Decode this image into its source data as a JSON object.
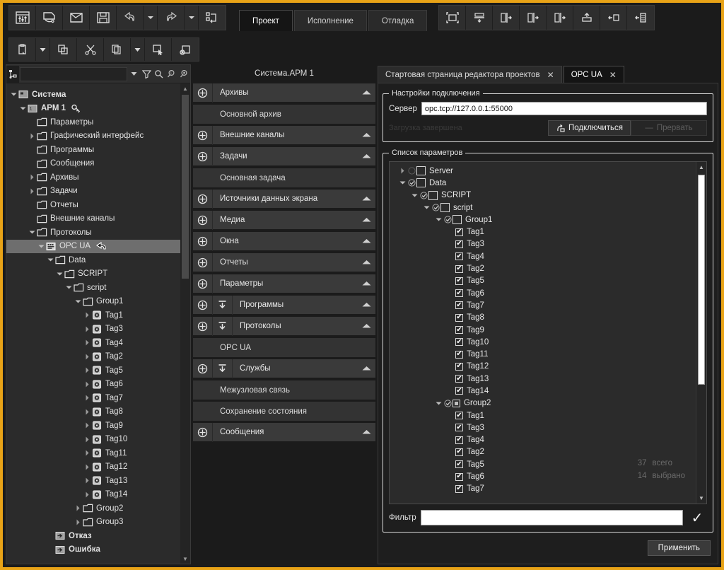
{
  "colors": {
    "accent": "#e8a317",
    "panel": "#2b2b2b",
    "bg": "#1b1b1b",
    "selection": "#6e6e6e"
  },
  "toolbar_main": {
    "buttons": [
      {
        "name": "project-settings-icon",
        "label": "Настройки проекта"
      },
      {
        "name": "new-project-icon",
        "label": "Новый проект"
      },
      {
        "name": "open-folder-icon",
        "label": "Открыть"
      },
      {
        "name": "save-icon",
        "label": "Сохранить"
      },
      {
        "name": "undo-icon",
        "label": "Отменить"
      },
      {
        "name": "undo-dropdown-icon",
        "label": ""
      },
      {
        "name": "redo-icon",
        "label": "Повторить"
      },
      {
        "name": "redo-dropdown-icon",
        "label": ""
      },
      {
        "name": "rebuild-icon",
        "label": "Пересобрать"
      }
    ]
  },
  "tabs": [
    {
      "label": "Проект",
      "active": true
    },
    {
      "label": "Исполнение",
      "active": false
    },
    {
      "label": "Отладка",
      "active": false
    }
  ],
  "toolbar_right": {
    "buttons": [
      {
        "name": "select-frame-icon",
        "label": "Рамка выделения"
      },
      {
        "name": "align-bottom-icon",
        "label": "Выровнять вниз"
      },
      {
        "name": "align-right-1-icon",
        "label": "Выровнять вправо"
      },
      {
        "name": "align-right-2-icon",
        "label": "Выровнять вправо"
      },
      {
        "name": "align-right-3-icon",
        "label": "Выровнять вправо"
      },
      {
        "name": "bring-front-icon",
        "label": "На передний план"
      },
      {
        "name": "align-left-icon",
        "label": "Выровнять влево"
      },
      {
        "name": "dock-left-icon",
        "label": "Закрепить слева"
      }
    ]
  },
  "toolbar_edit": {
    "buttons": [
      {
        "name": "paste-icon",
        "label": "Вставить"
      },
      {
        "name": "paste-dropdown-icon",
        "label": ""
      },
      {
        "name": "copy-icon",
        "label": "Копировать"
      },
      {
        "name": "cut-icon",
        "label": "Вырезать"
      },
      {
        "name": "duplicate-icon",
        "label": "Дублировать"
      },
      {
        "name": "duplicate-dropdown-icon",
        "label": ""
      },
      {
        "name": "select-icon",
        "label": "Выделить"
      },
      {
        "name": "delete-icon",
        "label": "Удалить"
      }
    ]
  },
  "tree_toolbar": {
    "mode_icon": "tree-mode-icon",
    "search_value": "",
    "search_placeholder": "",
    "buttons": [
      {
        "name": "search-dropdown-icon"
      },
      {
        "name": "filter-icon"
      },
      {
        "name": "search-icon"
      },
      {
        "name": "find-prev-icon"
      },
      {
        "name": "find-next-icon"
      }
    ]
  },
  "tree": {
    "nodes": [
      {
        "label": "Система",
        "depth": 0,
        "icon": "system-icon",
        "twisty": "down",
        "bold": true
      },
      {
        "label": "АРМ 1",
        "depth": 1,
        "icon": "workstation-icon",
        "twisty": "down",
        "bold": true,
        "badge": "key-icon"
      },
      {
        "label": "Параметры",
        "depth": 2,
        "icon": "folder-icon",
        "twisty": ""
      },
      {
        "label": "Графический интерфейс",
        "depth": 2,
        "icon": "folder-icon",
        "twisty": "right"
      },
      {
        "label": "Программы",
        "depth": 2,
        "icon": "folder-icon",
        "twisty": ""
      },
      {
        "label": "Сообщения",
        "depth": 2,
        "icon": "folder-icon",
        "twisty": ""
      },
      {
        "label": "Архивы",
        "depth": 2,
        "icon": "folder-icon",
        "twisty": "right"
      },
      {
        "label": "Задачи",
        "depth": 2,
        "icon": "folder-icon",
        "twisty": "right"
      },
      {
        "label": "Отчеты",
        "depth": 2,
        "icon": "folder-icon",
        "twisty": ""
      },
      {
        "label": "Внешние каналы",
        "depth": 2,
        "icon": "folder-icon",
        "twisty": ""
      },
      {
        "label": "Протоколы",
        "depth": 2,
        "icon": "folder-icon",
        "twisty": "down"
      },
      {
        "label": "OPC UA",
        "depth": 3,
        "icon": "opcua-icon",
        "twisty": "down",
        "selected": true,
        "badge": "back-arrow-icon"
      },
      {
        "label": "Data",
        "depth": 4,
        "icon": "folder-icon",
        "twisty": "down"
      },
      {
        "label": "SCRIPT",
        "depth": 5,
        "icon": "folder-icon",
        "twisty": "down"
      },
      {
        "label": "script",
        "depth": 6,
        "icon": "folder-icon",
        "twisty": "down"
      },
      {
        "label": "Group1",
        "depth": 7,
        "icon": "folder-icon",
        "twisty": "down"
      },
      {
        "label": "Tag1",
        "depth": 8,
        "icon": "tag-icon",
        "twisty": "right"
      },
      {
        "label": "Tag3",
        "depth": 8,
        "icon": "tag-icon",
        "twisty": "right"
      },
      {
        "label": "Tag4",
        "depth": 8,
        "icon": "tag-icon",
        "twisty": "right"
      },
      {
        "label": "Tag2",
        "depth": 8,
        "icon": "tag-icon",
        "twisty": "right"
      },
      {
        "label": "Tag5",
        "depth": 8,
        "icon": "tag-icon",
        "twisty": "right"
      },
      {
        "label": "Tag6",
        "depth": 8,
        "icon": "tag-icon",
        "twisty": "right"
      },
      {
        "label": "Tag7",
        "depth": 8,
        "icon": "tag-icon",
        "twisty": "right"
      },
      {
        "label": "Tag8",
        "depth": 8,
        "icon": "tag-icon",
        "twisty": "right"
      },
      {
        "label": "Tag9",
        "depth": 8,
        "icon": "tag-icon",
        "twisty": "right"
      },
      {
        "label": "Tag10",
        "depth": 8,
        "icon": "tag-icon",
        "twisty": "right"
      },
      {
        "label": "Tag11",
        "depth": 8,
        "icon": "tag-icon",
        "twisty": "right"
      },
      {
        "label": "Tag12",
        "depth": 8,
        "icon": "tag-icon",
        "twisty": "right"
      },
      {
        "label": "Tag13",
        "depth": 8,
        "icon": "tag-icon",
        "twisty": "right"
      },
      {
        "label": "Tag14",
        "depth": 8,
        "icon": "tag-icon",
        "twisty": "right"
      },
      {
        "label": "Group2",
        "depth": 7,
        "icon": "folder-icon",
        "twisty": "right"
      },
      {
        "label": "Group3",
        "depth": 7,
        "icon": "folder-icon",
        "twisty": "right"
      },
      {
        "label": "Отказ",
        "depth": 4,
        "icon": "signal-icon",
        "twisty": "",
        "bold": true
      },
      {
        "label": "Ошибка",
        "depth": 4,
        "icon": "signal-icon",
        "twisty": "",
        "bold": true
      }
    ]
  },
  "middle": {
    "title": "Система.АРМ 1",
    "items": [
      {
        "label": "Архивы",
        "type": "group",
        "plus": true,
        "down": false
      },
      {
        "label": "Основной архив",
        "type": "child"
      },
      {
        "label": "Внешние каналы",
        "type": "group",
        "plus": true,
        "down": false
      },
      {
        "label": "Задачи",
        "type": "group",
        "plus": true,
        "down": false
      },
      {
        "label": "Основная задача",
        "type": "child"
      },
      {
        "label": "Источники данных экрана",
        "type": "group",
        "plus": true,
        "down": false
      },
      {
        "label": "Медиа",
        "type": "group",
        "plus": true,
        "down": false
      },
      {
        "label": "Окна",
        "type": "group",
        "plus": true,
        "down": false
      },
      {
        "label": "Отчеты",
        "type": "group",
        "plus": true,
        "down": false
      },
      {
        "label": "Параметры",
        "type": "group",
        "plus": true,
        "down": false
      },
      {
        "label": "Программы",
        "type": "group",
        "plus": true,
        "down": true
      },
      {
        "label": "Протоколы",
        "type": "group",
        "plus": true,
        "down": true
      },
      {
        "label": "OPC UA",
        "type": "child"
      },
      {
        "label": "Службы",
        "type": "group",
        "plus": true,
        "down": true
      },
      {
        "label": "Межузловая связь",
        "type": "child"
      },
      {
        "label": "Сохранение состояния",
        "type": "child"
      },
      {
        "label": "Сообщения",
        "type": "group",
        "plus": true,
        "down": false
      }
    ]
  },
  "doc_tabs": [
    {
      "label": "Стартовая страница редактора проектов",
      "active": false,
      "close": "✕"
    },
    {
      "label": "OPC UA",
      "active": true,
      "close": "✕"
    }
  ],
  "connection": {
    "legend": "Настройки подключения",
    "server_label": "Сервер",
    "server_value": "opc.tcp://127.0.0.1:55000",
    "status": "Загрузка завершена",
    "connect_label": "Подключиться",
    "abort_label": "Прервать"
  },
  "params": {
    "legend": "Список параметров",
    "total_value": "37",
    "total_label": "всего",
    "selected_value": "14",
    "selected_label": "выбрано",
    "nodes": [
      {
        "label": "Server",
        "depth": 0,
        "twisty": "right",
        "circle": "empty",
        "check": "none"
      },
      {
        "label": "Data",
        "depth": 0,
        "twisty": "down",
        "circle": "check",
        "check": "none"
      },
      {
        "label": "SCRIPT",
        "depth": 1,
        "twisty": "down",
        "circle": "check",
        "check": "none"
      },
      {
        "label": "script",
        "depth": 2,
        "twisty": "down",
        "circle": "check",
        "check": "none"
      },
      {
        "label": "Group1",
        "depth": 3,
        "twisty": "down",
        "circle": "check",
        "check": "none"
      },
      {
        "label": "Tag1",
        "depth": 4,
        "twisty": "",
        "circle": "",
        "check": "checked"
      },
      {
        "label": "Tag3",
        "depth": 4,
        "twisty": "",
        "circle": "",
        "check": "checked"
      },
      {
        "label": "Tag4",
        "depth": 4,
        "twisty": "",
        "circle": "",
        "check": "checked"
      },
      {
        "label": "Tag2",
        "depth": 4,
        "twisty": "",
        "circle": "",
        "check": "checked"
      },
      {
        "label": "Tag5",
        "depth": 4,
        "twisty": "",
        "circle": "",
        "check": "checked"
      },
      {
        "label": "Tag6",
        "depth": 4,
        "twisty": "",
        "circle": "",
        "check": "checked"
      },
      {
        "label": "Tag7",
        "depth": 4,
        "twisty": "",
        "circle": "",
        "check": "checked"
      },
      {
        "label": "Tag8",
        "depth": 4,
        "twisty": "",
        "circle": "",
        "check": "checked"
      },
      {
        "label": "Tag9",
        "depth": 4,
        "twisty": "",
        "circle": "",
        "check": "checked"
      },
      {
        "label": "Tag10",
        "depth": 4,
        "twisty": "",
        "circle": "",
        "check": "checked"
      },
      {
        "label": "Tag11",
        "depth": 4,
        "twisty": "",
        "circle": "",
        "check": "checked"
      },
      {
        "label": "Tag12",
        "depth": 4,
        "twisty": "",
        "circle": "",
        "check": "checked"
      },
      {
        "label": "Tag13",
        "depth": 4,
        "twisty": "",
        "circle": "",
        "check": "checked"
      },
      {
        "label": "Tag14",
        "depth": 4,
        "twisty": "",
        "circle": "",
        "check": "checked"
      },
      {
        "label": "Group2",
        "depth": 3,
        "twisty": "down",
        "circle": "check",
        "check": "part"
      },
      {
        "label": "Tag1",
        "depth": 4,
        "twisty": "",
        "circle": "",
        "check": "checked"
      },
      {
        "label": "Tag3",
        "depth": 4,
        "twisty": "",
        "circle": "",
        "check": "checked"
      },
      {
        "label": "Tag4",
        "depth": 4,
        "twisty": "",
        "circle": "",
        "check": "checked"
      },
      {
        "label": "Tag2",
        "depth": 4,
        "twisty": "",
        "circle": "",
        "check": "checked"
      },
      {
        "label": "Tag5",
        "depth": 4,
        "twisty": "",
        "circle": "",
        "check": "checked"
      },
      {
        "label": "Tag6",
        "depth": 4,
        "twisty": "",
        "circle": "",
        "check": "checked"
      },
      {
        "label": "Tag7",
        "depth": 4,
        "twisty": "",
        "circle": "",
        "check": "checked"
      }
    ]
  },
  "filter": {
    "label": "Фильтр",
    "value": "",
    "placeholder": "",
    "ok_icon": "✓"
  },
  "footer": {
    "apply_label": "Применить"
  }
}
